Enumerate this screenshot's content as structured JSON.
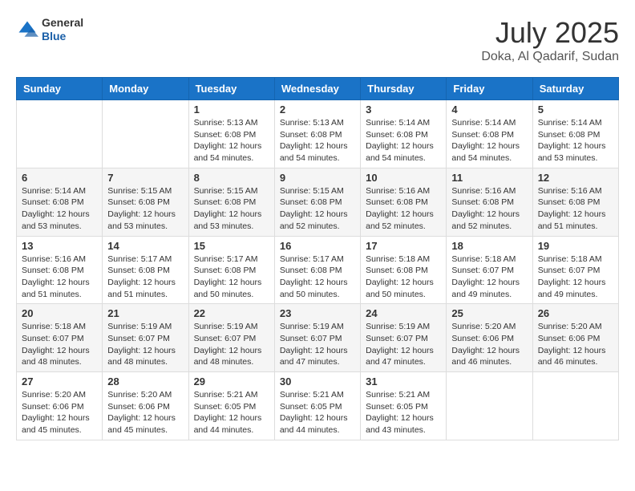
{
  "header": {
    "logo_general": "General",
    "logo_blue": "Blue",
    "month": "July 2025",
    "location": "Doka, Al Qadarif, Sudan"
  },
  "days_of_week": [
    "Sunday",
    "Monday",
    "Tuesday",
    "Wednesday",
    "Thursday",
    "Friday",
    "Saturday"
  ],
  "weeks": [
    [
      {
        "day": "",
        "sunrise": "",
        "sunset": "",
        "daylight": ""
      },
      {
        "day": "",
        "sunrise": "",
        "sunset": "",
        "daylight": ""
      },
      {
        "day": "1",
        "sunrise": "Sunrise: 5:13 AM",
        "sunset": "Sunset: 6:08 PM",
        "daylight": "Daylight: 12 hours and 54 minutes."
      },
      {
        "day": "2",
        "sunrise": "Sunrise: 5:13 AM",
        "sunset": "Sunset: 6:08 PM",
        "daylight": "Daylight: 12 hours and 54 minutes."
      },
      {
        "day": "3",
        "sunrise": "Sunrise: 5:14 AM",
        "sunset": "Sunset: 6:08 PM",
        "daylight": "Daylight: 12 hours and 54 minutes."
      },
      {
        "day": "4",
        "sunrise": "Sunrise: 5:14 AM",
        "sunset": "Sunset: 6:08 PM",
        "daylight": "Daylight: 12 hours and 54 minutes."
      },
      {
        "day": "5",
        "sunrise": "Sunrise: 5:14 AM",
        "sunset": "Sunset: 6:08 PM",
        "daylight": "Daylight: 12 hours and 53 minutes."
      }
    ],
    [
      {
        "day": "6",
        "sunrise": "Sunrise: 5:14 AM",
        "sunset": "Sunset: 6:08 PM",
        "daylight": "Daylight: 12 hours and 53 minutes."
      },
      {
        "day": "7",
        "sunrise": "Sunrise: 5:15 AM",
        "sunset": "Sunset: 6:08 PM",
        "daylight": "Daylight: 12 hours and 53 minutes."
      },
      {
        "day": "8",
        "sunrise": "Sunrise: 5:15 AM",
        "sunset": "Sunset: 6:08 PM",
        "daylight": "Daylight: 12 hours and 53 minutes."
      },
      {
        "day": "9",
        "sunrise": "Sunrise: 5:15 AM",
        "sunset": "Sunset: 6:08 PM",
        "daylight": "Daylight: 12 hours and 52 minutes."
      },
      {
        "day": "10",
        "sunrise": "Sunrise: 5:16 AM",
        "sunset": "Sunset: 6:08 PM",
        "daylight": "Daylight: 12 hours and 52 minutes."
      },
      {
        "day": "11",
        "sunrise": "Sunrise: 5:16 AM",
        "sunset": "Sunset: 6:08 PM",
        "daylight": "Daylight: 12 hours and 52 minutes."
      },
      {
        "day": "12",
        "sunrise": "Sunrise: 5:16 AM",
        "sunset": "Sunset: 6:08 PM",
        "daylight": "Daylight: 12 hours and 51 minutes."
      }
    ],
    [
      {
        "day": "13",
        "sunrise": "Sunrise: 5:16 AM",
        "sunset": "Sunset: 6:08 PM",
        "daylight": "Daylight: 12 hours and 51 minutes."
      },
      {
        "day": "14",
        "sunrise": "Sunrise: 5:17 AM",
        "sunset": "Sunset: 6:08 PM",
        "daylight": "Daylight: 12 hours and 51 minutes."
      },
      {
        "day": "15",
        "sunrise": "Sunrise: 5:17 AM",
        "sunset": "Sunset: 6:08 PM",
        "daylight": "Daylight: 12 hours and 50 minutes."
      },
      {
        "day": "16",
        "sunrise": "Sunrise: 5:17 AM",
        "sunset": "Sunset: 6:08 PM",
        "daylight": "Daylight: 12 hours and 50 minutes."
      },
      {
        "day": "17",
        "sunrise": "Sunrise: 5:18 AM",
        "sunset": "Sunset: 6:08 PM",
        "daylight": "Daylight: 12 hours and 50 minutes."
      },
      {
        "day": "18",
        "sunrise": "Sunrise: 5:18 AM",
        "sunset": "Sunset: 6:07 PM",
        "daylight": "Daylight: 12 hours and 49 minutes."
      },
      {
        "day": "19",
        "sunrise": "Sunrise: 5:18 AM",
        "sunset": "Sunset: 6:07 PM",
        "daylight": "Daylight: 12 hours and 49 minutes."
      }
    ],
    [
      {
        "day": "20",
        "sunrise": "Sunrise: 5:18 AM",
        "sunset": "Sunset: 6:07 PM",
        "daylight": "Daylight: 12 hours and 48 minutes."
      },
      {
        "day": "21",
        "sunrise": "Sunrise: 5:19 AM",
        "sunset": "Sunset: 6:07 PM",
        "daylight": "Daylight: 12 hours and 48 minutes."
      },
      {
        "day": "22",
        "sunrise": "Sunrise: 5:19 AM",
        "sunset": "Sunset: 6:07 PM",
        "daylight": "Daylight: 12 hours and 48 minutes."
      },
      {
        "day": "23",
        "sunrise": "Sunrise: 5:19 AM",
        "sunset": "Sunset: 6:07 PM",
        "daylight": "Daylight: 12 hours and 47 minutes."
      },
      {
        "day": "24",
        "sunrise": "Sunrise: 5:19 AM",
        "sunset": "Sunset: 6:07 PM",
        "daylight": "Daylight: 12 hours and 47 minutes."
      },
      {
        "day": "25",
        "sunrise": "Sunrise: 5:20 AM",
        "sunset": "Sunset: 6:06 PM",
        "daylight": "Daylight: 12 hours and 46 minutes."
      },
      {
        "day": "26",
        "sunrise": "Sunrise: 5:20 AM",
        "sunset": "Sunset: 6:06 PM",
        "daylight": "Daylight: 12 hours and 46 minutes."
      }
    ],
    [
      {
        "day": "27",
        "sunrise": "Sunrise: 5:20 AM",
        "sunset": "Sunset: 6:06 PM",
        "daylight": "Daylight: 12 hours and 45 minutes."
      },
      {
        "day": "28",
        "sunrise": "Sunrise: 5:20 AM",
        "sunset": "Sunset: 6:06 PM",
        "daylight": "Daylight: 12 hours and 45 minutes."
      },
      {
        "day": "29",
        "sunrise": "Sunrise: 5:21 AM",
        "sunset": "Sunset: 6:05 PM",
        "daylight": "Daylight: 12 hours and 44 minutes."
      },
      {
        "day": "30",
        "sunrise": "Sunrise: 5:21 AM",
        "sunset": "Sunset: 6:05 PM",
        "daylight": "Daylight: 12 hours and 44 minutes."
      },
      {
        "day": "31",
        "sunrise": "Sunrise: 5:21 AM",
        "sunset": "Sunset: 6:05 PM",
        "daylight": "Daylight: 12 hours and 43 minutes."
      },
      {
        "day": "",
        "sunrise": "",
        "sunset": "",
        "daylight": ""
      },
      {
        "day": "",
        "sunrise": "",
        "sunset": "",
        "daylight": ""
      }
    ]
  ]
}
